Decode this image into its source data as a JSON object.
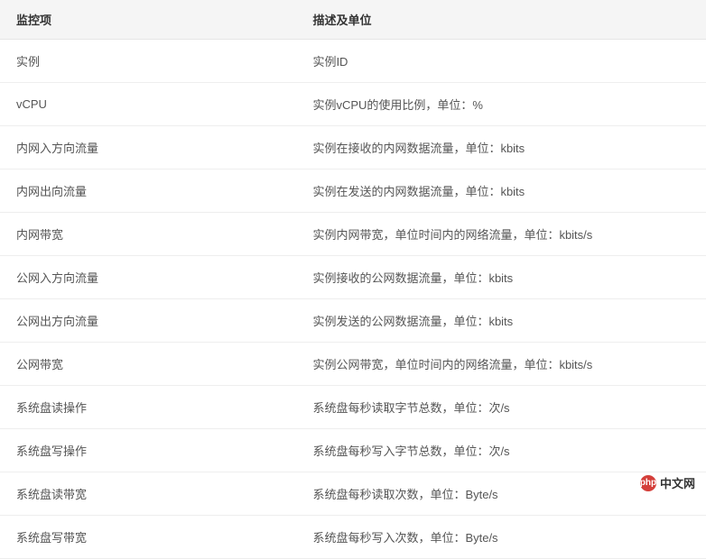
{
  "table": {
    "headers": [
      "监控项",
      "描述及单位"
    ],
    "rows": [
      {
        "item": "实例",
        "desc": "实例ID"
      },
      {
        "item": "vCPU",
        "desc": "实例vCPU的使用比例，单位：%"
      },
      {
        "item": "内网入方向流量",
        "desc": "实例在接收的内网数据流量，单位：kbits"
      },
      {
        "item": "内网出向流量",
        "desc": "实例在发送的内网数据流量，单位：kbits"
      },
      {
        "item": "内网带宽",
        "desc": "实例内网带宽，单位时间内的网络流量，单位：kbits/s"
      },
      {
        "item": "公网入方向流量",
        "desc": "实例接收的公网数据流量，单位：kbits"
      },
      {
        "item": "公网出方向流量",
        "desc": "实例发送的公网数据流量，单位：kbits"
      },
      {
        "item": "公网带宽",
        "desc": "实例公网带宽，单位时间内的网络流量，单位：kbits/s"
      },
      {
        "item": "系统盘读操作",
        "desc": "系统盘每秒读取字节总数，单位：次/s"
      },
      {
        "item": "系统盘写操作",
        "desc": "系统盘每秒写入字节总数，单位：次/s"
      },
      {
        "item": "系统盘读带宽",
        "desc": "系统盘每秒读取次数，单位：Byte/s"
      },
      {
        "item": "系统盘写带宽",
        "desc": "系统盘每秒写入次数，单位：Byte/s"
      }
    ]
  },
  "watermark": {
    "logo": "php",
    "text": "中文网"
  }
}
